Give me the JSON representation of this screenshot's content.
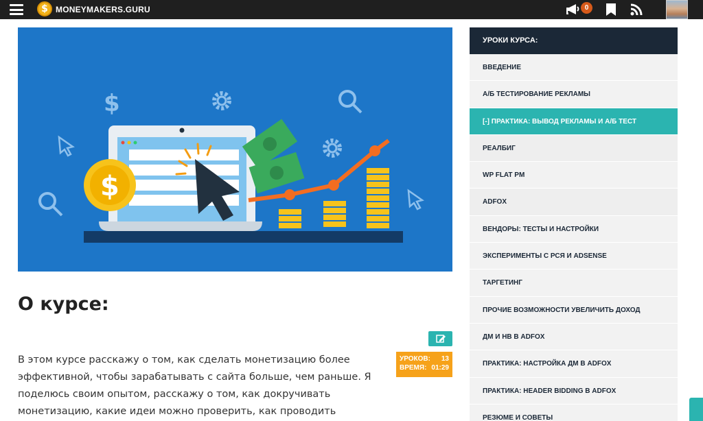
{
  "header": {
    "logo_symbol": "$",
    "site_name": "MONEYMAKERS.GURU",
    "notifications_count": "0",
    "icons": [
      "menu-icon",
      "megaphone-icon",
      "bookmark-icon",
      "rss-icon"
    ]
  },
  "hero": {
    "coin_symbol": "$",
    "icons": [
      "dollar-icon",
      "gear-icon",
      "search-icon",
      "cursor-icon",
      "laptop-illustration",
      "money-icon",
      "growth-chart"
    ]
  },
  "about": {
    "title": "О курсе:",
    "lessons_label": "УРОКОВ:",
    "lessons_value": "13",
    "time_label": "ВРЕМЯ:",
    "time_value": "01:29",
    "description": "В этом курсе расскажу о том, как сделать монетизацию более эффективной, чтобы зарабатывать с сайта больше, чем раньше. Я поделюсь своим опытом, расскажу о том, как докручивать монетизацию, какие идеи можно проверить, как проводить эксперименты и какие системы"
  },
  "sidebar": {
    "title": "УРОКИ КУРСА:",
    "items": [
      {
        "label": "ВВЕДЕНИЕ",
        "active": false
      },
      {
        "label": "А/Б ТЕСТИРОВАНИЕ РЕКЛАМЫ",
        "active": false
      },
      {
        "label": "[-] ПРАКТИКА: ВЫВОД РЕКЛАМЫ И А/Б ТЕСТ",
        "active": true
      },
      {
        "label": "РЕАЛБИГ",
        "active": false
      },
      {
        "label": "WP FLAT PM",
        "active": false
      },
      {
        "label": "ADFOX",
        "active": false
      },
      {
        "label": "ВЕНДОРЫ: ТЕСТЫ И НАСТРОЙКИ",
        "active": false
      },
      {
        "label": "ЭКСПЕРИМЕНТЫ С РСЯ И ADSENSE",
        "active": false
      },
      {
        "label": "ТАРГЕТИНГ",
        "active": false
      },
      {
        "label": "ПРОЧИЕ ВОЗМОЖНОСТИ УВЕЛИЧИТЬ ДОХОД",
        "active": false
      },
      {
        "label": "ДМ И НВ В ADFOX",
        "active": false
      },
      {
        "label": "ПРАКТИКА: НАСТРОЙКА ДМ В ADFOX",
        "active": false
      },
      {
        "label": "ПРАКТИКА: HEADER BIDDING В ADFOX",
        "active": false
      },
      {
        "label": "РЕЗЮМЕ И СОВЕТЫ",
        "active": false
      }
    ]
  },
  "colors": {
    "topbar": "#1f1f1f",
    "accent": "#2bb4b0",
    "sidebar_header": "#1b2837",
    "stats_badge": "#f6a21a",
    "hero_bg": "#1d76c8"
  }
}
